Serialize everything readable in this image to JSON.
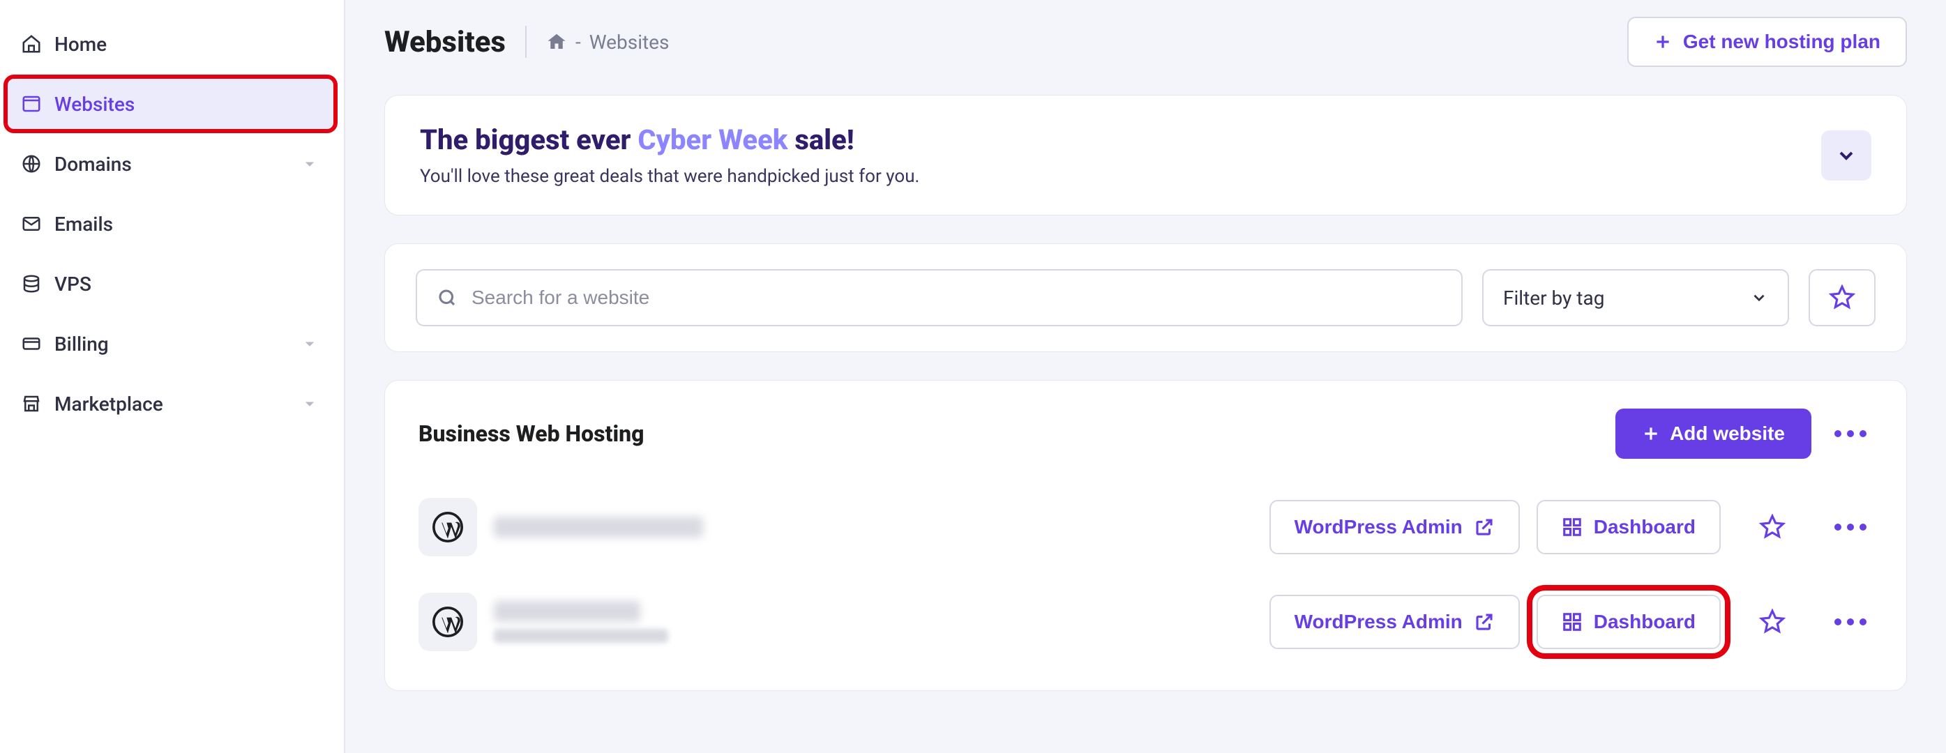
{
  "sidebar": {
    "items": [
      {
        "label": "Home",
        "icon": "home",
        "active": false,
        "expandable": false
      },
      {
        "label": "Websites",
        "icon": "window",
        "active": true,
        "expandable": false,
        "highlighted": true
      },
      {
        "label": "Domains",
        "icon": "globe",
        "active": false,
        "expandable": true
      },
      {
        "label": "Emails",
        "icon": "mail",
        "active": false,
        "expandable": false
      },
      {
        "label": "VPS",
        "icon": "server",
        "active": false,
        "expandable": false
      },
      {
        "label": "Billing",
        "icon": "card",
        "active": false,
        "expandable": true
      },
      {
        "label": "Marketplace",
        "icon": "store",
        "active": false,
        "expandable": true
      }
    ]
  },
  "header": {
    "title": "Websites",
    "breadcrumb_sep": "-",
    "breadcrumb_current": "Websites",
    "new_plan_label": "Get new hosting plan"
  },
  "promo": {
    "title_pre": "The biggest ever ",
    "title_highlight": "Cyber Week",
    "title_post": " sale!",
    "subtitle": "You'll love these great deals that were handpicked just for you."
  },
  "search": {
    "placeholder": "Search for a website",
    "filter_label": "Filter by tag"
  },
  "hosting": {
    "group_title": "Business Web Hosting",
    "add_label": "Add website",
    "wp_admin_label": "WordPress Admin",
    "dashboard_label": "Dashboard",
    "sites": [
      {
        "id": 0
      },
      {
        "id": 1,
        "dashboard_highlighted": true
      }
    ]
  }
}
